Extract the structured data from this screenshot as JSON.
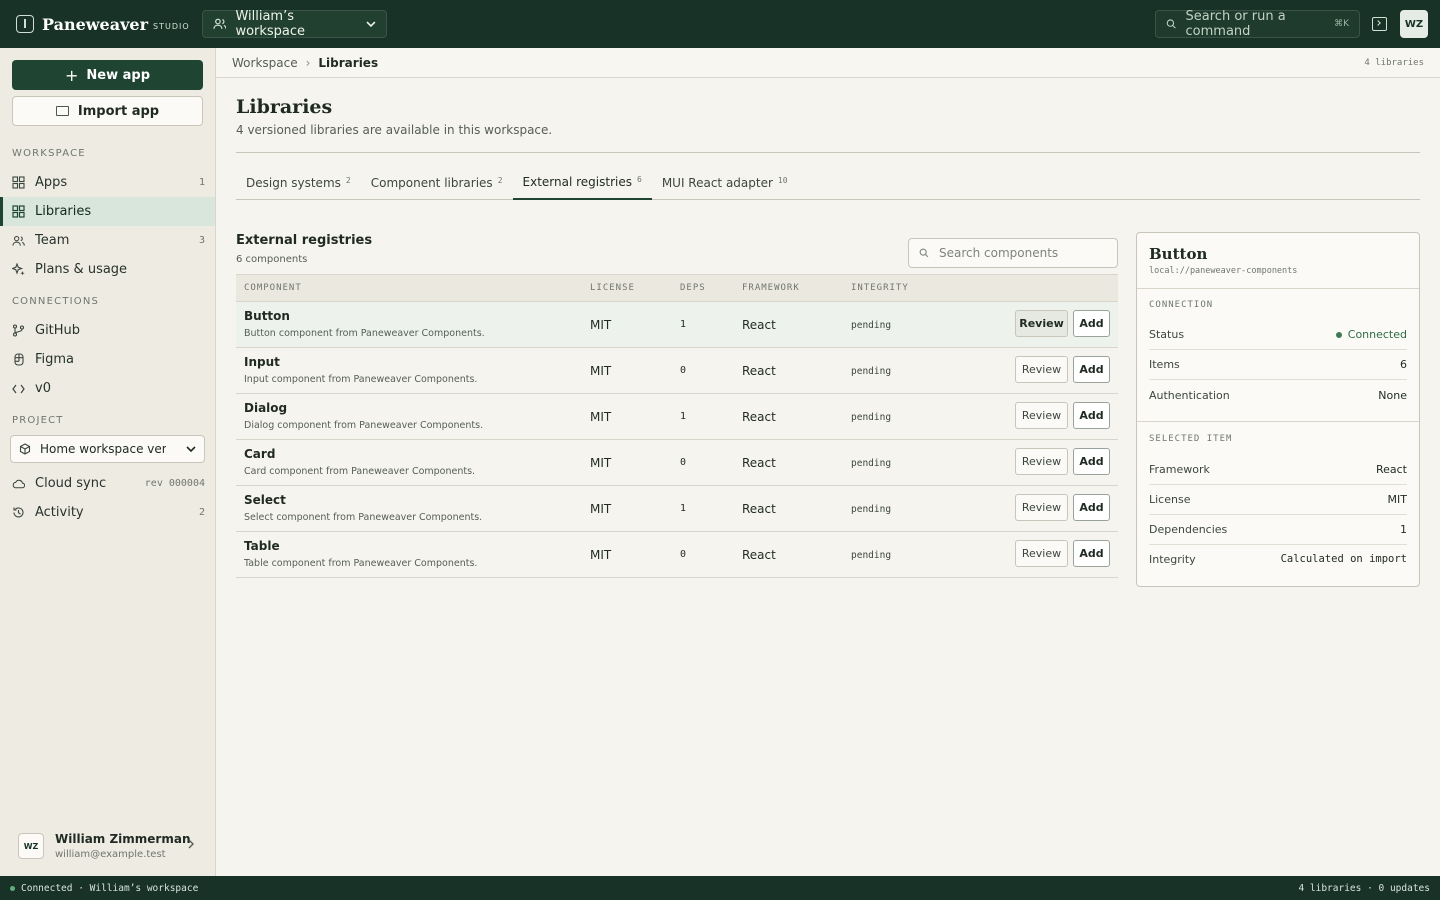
{
  "brand": {
    "name": "Paneweaver",
    "tag": "STUDIO"
  },
  "workspace_select": {
    "label": "William’s workspace"
  },
  "top_search": {
    "placeholder": "Search or run a command",
    "shortcut": "⌘K"
  },
  "top_avatar": {
    "initials": "WZ"
  },
  "sidebar": {
    "new_app": "New app",
    "import_app": "Import app",
    "workspace_label": "WORKSPACE",
    "workspace_items": [
      {
        "label": "Apps",
        "count": "1",
        "icon": "grid-icon"
      },
      {
        "label": "Libraries",
        "count": "",
        "icon": "grid-icon",
        "active": true
      },
      {
        "label": "Team",
        "count": "3",
        "icon": "people-icon"
      },
      {
        "label": "Plans & usage",
        "count": "",
        "icon": "sparkle-icon"
      }
    ],
    "connections_label": "CONNECTIONS",
    "connection_items": [
      {
        "label": "GitHub",
        "icon": "git-branch-icon"
      },
      {
        "label": "Figma",
        "icon": "figma-icon"
      },
      {
        "label": "v0",
        "icon": "code-icon"
      }
    ],
    "project_label": "PROJECT",
    "project_select": "Home workspace version",
    "project_items": [
      {
        "label": "Cloud sync",
        "count": "rev 000004",
        "icon": "cloud-icon"
      },
      {
        "label": "Activity",
        "count": "2",
        "icon": "history-icon"
      }
    ],
    "user": {
      "initials": "WZ",
      "name": "William Zimmerman",
      "email": "william@example.test"
    }
  },
  "breadcrumb": {
    "root": "Workspace",
    "current": "Libraries",
    "meta": "4 libraries"
  },
  "page": {
    "title": "Libraries",
    "subtitle": "4 versioned libraries are available in this workspace."
  },
  "tabs": [
    {
      "label": "Design systems",
      "count": "2"
    },
    {
      "label": "Component libraries",
      "count": "2"
    },
    {
      "label": "External registries",
      "count": "6",
      "active": true
    },
    {
      "label": "MUI React adapter",
      "count": "10"
    }
  ],
  "section": {
    "title": "External registries",
    "subtitle": "6 components",
    "search_placeholder": "Search components"
  },
  "table": {
    "headers": {
      "component": "COMPONENT",
      "license": "LICENSE",
      "deps": "DEPS",
      "framework": "FRAMEWORK",
      "integrity": "INTEGRITY"
    },
    "review_label": "Review",
    "add_label": "Add",
    "rows": [
      {
        "name": "Button",
        "desc": "Button component from Paneweaver Components.",
        "license": "MIT",
        "deps": "1",
        "framework": "React",
        "integrity": "pending"
      },
      {
        "name": "Input",
        "desc": "Input component from Paneweaver Components.",
        "license": "MIT",
        "deps": "0",
        "framework": "React",
        "integrity": "pending"
      },
      {
        "name": "Dialog",
        "desc": "Dialog component from Paneweaver Components.",
        "license": "MIT",
        "deps": "1",
        "framework": "React",
        "integrity": "pending"
      },
      {
        "name": "Card",
        "desc": "Card component from Paneweaver Components.",
        "license": "MIT",
        "deps": "0",
        "framework": "React",
        "integrity": "pending"
      },
      {
        "name": "Select",
        "desc": "Select component from Paneweaver Components.",
        "license": "MIT",
        "deps": "1",
        "framework": "React",
        "integrity": "pending"
      },
      {
        "name": "Table",
        "desc": "Table component from Paneweaver Components.",
        "license": "MIT",
        "deps": "0",
        "framework": "React",
        "integrity": "pending"
      }
    ]
  },
  "detail": {
    "title": "Button",
    "source": "local://paneweaver-components",
    "connection_label": "CONNECTION",
    "status_key": "Status",
    "status_val": "Connected",
    "items_key": "Items",
    "items_val": "6",
    "auth_key": "Authentication",
    "auth_val": "None",
    "selected_label": "SELECTED ITEM",
    "framework_key": "Framework",
    "framework_val": "React",
    "license_key": "License",
    "license_val": "MIT",
    "deps_key": "Dependencies",
    "deps_val": "1",
    "integrity_key": "Integrity",
    "integrity_val": "Calculated on import"
  },
  "statusbar": {
    "left": "Connected · William’s workspace",
    "right": "4 libraries · 0 updates"
  },
  "colors": {
    "topbar": "#183228",
    "accent": "#1f4532",
    "status_green": "#3f7a55"
  }
}
